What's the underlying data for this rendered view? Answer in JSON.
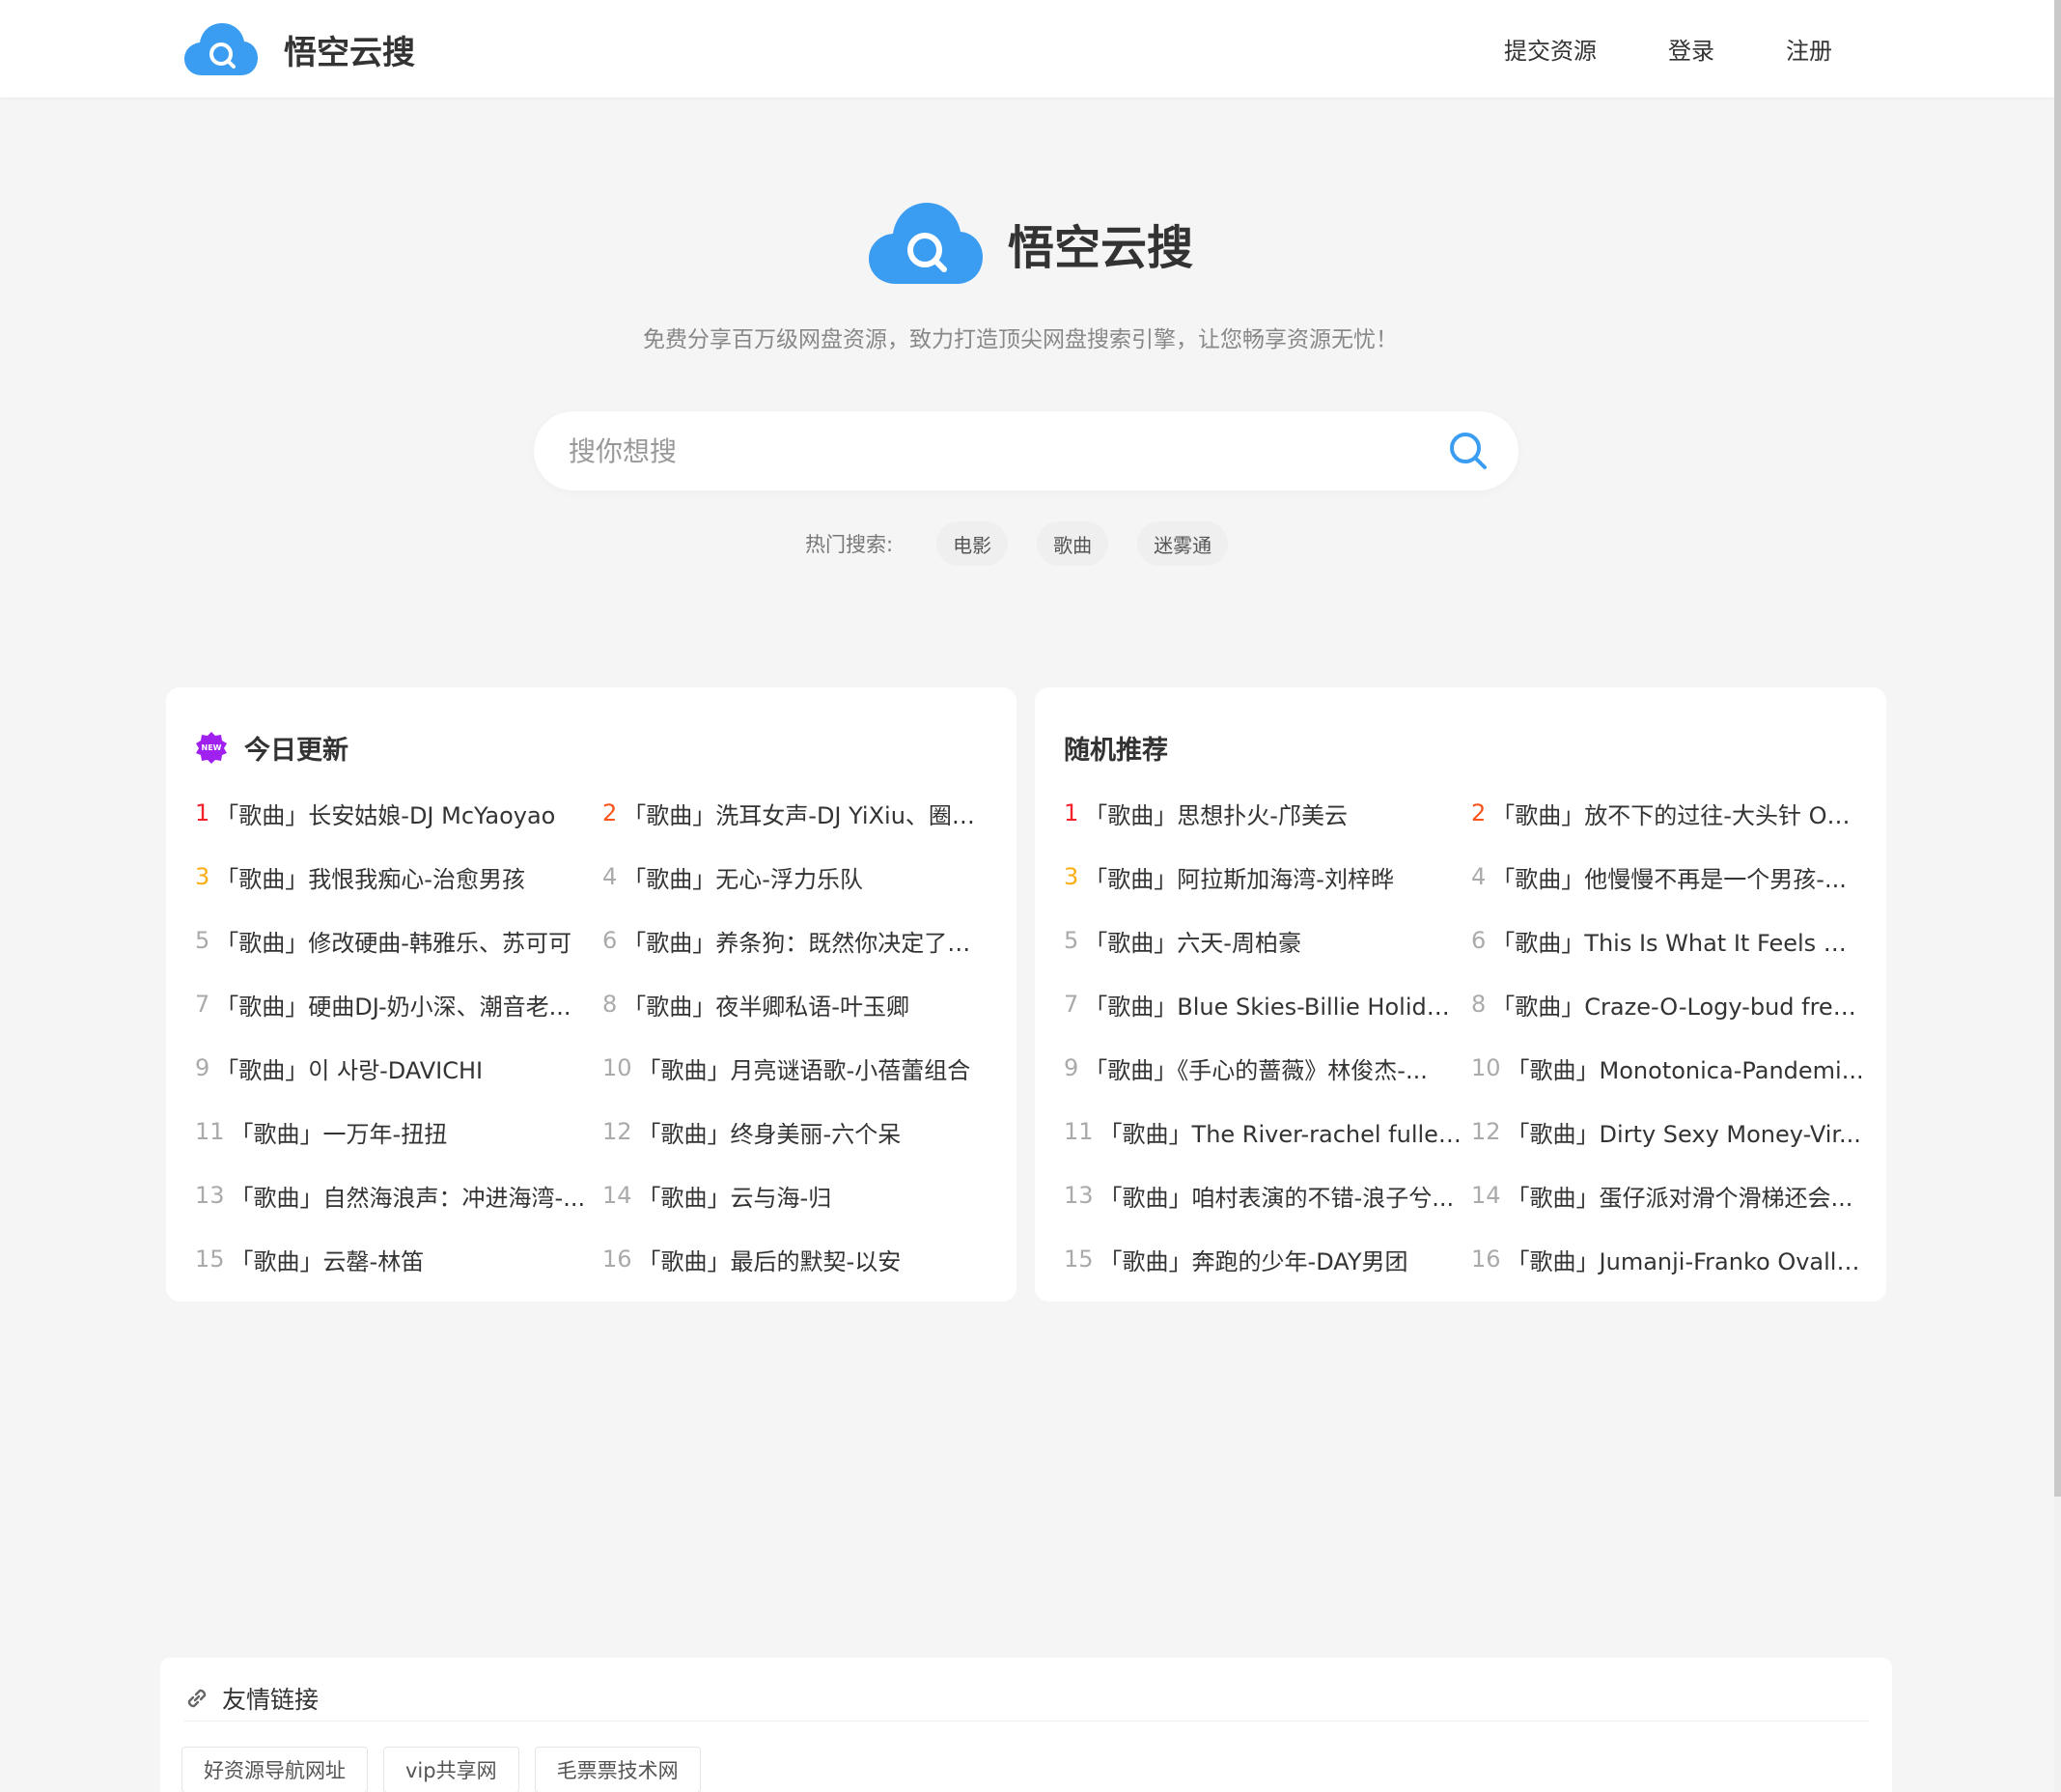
{
  "brand": {
    "name": "悟空云搜",
    "accent": "#3b9df2",
    "slogan": "免费分享百万级网盘资源，致力打造顶尖网盘搜索引擎，让您畅享资源无忧！"
  },
  "nav": {
    "submit": "提交资源",
    "login": "登录",
    "register": "注册"
  },
  "search": {
    "placeholder": "搜你想搜",
    "value": ""
  },
  "hot": {
    "label": "热门搜索:",
    "tags": [
      "电影",
      "歌曲",
      "迷雾通"
    ]
  },
  "today": {
    "title": "今日更新",
    "badge_text": "NEW",
    "items": [
      {
        "num": "1",
        "text": "「歌曲」长安姑娘-DJ McYaoyao"
      },
      {
        "num": "2",
        "text": "「歌曲」洗耳女声-DJ YiXiu、圈妹..."
      },
      {
        "num": "3",
        "text": "「歌曲」我恨我痴心-治愈男孩"
      },
      {
        "num": "4",
        "text": "「歌曲」无心-浮力乐队"
      },
      {
        "num": "5",
        "text": "「歌曲」修改硬曲-韩雅乐、苏可可"
      },
      {
        "num": "6",
        "text": "「歌曲」养条狗：既然你决定了要..."
      },
      {
        "num": "7",
        "text": "「歌曲」硬曲DJ-奶小深、潮音老..."
      },
      {
        "num": "8",
        "text": "「歌曲」夜半卿私语-叶玉卿"
      },
      {
        "num": "9",
        "text": "「歌曲」이 사랑-DAVICHI"
      },
      {
        "num": "10",
        "text": "「歌曲」月亮谜语歌-小蓓蕾组合"
      },
      {
        "num": "11",
        "text": "「歌曲」一万年-扭扭"
      },
      {
        "num": "12",
        "text": "「歌曲」终身美丽-六个呆"
      },
      {
        "num": "13",
        "text": "「歌曲」自然海浪声：冲进海湾-..."
      },
      {
        "num": "14",
        "text": "「歌曲」云与海-归"
      },
      {
        "num": "15",
        "text": "「歌曲」云罄-林笛"
      },
      {
        "num": "16",
        "text": "「歌曲」最后的默契-以安"
      }
    ]
  },
  "random": {
    "title": "随机推荐",
    "items": [
      {
        "num": "1",
        "text": "「歌曲」思想扑火-邝美云"
      },
      {
        "num": "2",
        "text": "「歌曲」放不下的过往-大头针 Off..."
      },
      {
        "num": "3",
        "text": "「歌曲」阿拉斯加海湾-刘梓晔"
      },
      {
        "num": "4",
        "text": "「歌曲」他慢慢不再是一个男孩-..."
      },
      {
        "num": "5",
        "text": "「歌曲」六天-周柏豪"
      },
      {
        "num": "6",
        "text": "「歌曲」This Is What It Feels Lik..."
      },
      {
        "num": "7",
        "text": "「歌曲」Blue Skies-Billie Holiday"
      },
      {
        "num": "8",
        "text": "「歌曲」Craze-O-Logy-bud free..."
      },
      {
        "num": "9",
        "text": "「歌曲」《手心的蔷薇》林俊杰-..."
      },
      {
        "num": "10",
        "text": "「歌曲」Monotonica-Pandemi..."
      },
      {
        "num": "11",
        "text": "「歌曲」The River-rachel fuller..."
      },
      {
        "num": "12",
        "text": "「歌曲」Dirty Sexy Money-Vir..."
      },
      {
        "num": "13",
        "text": "「歌曲」咱村表演的不错-浪子兮..."
      },
      {
        "num": "14",
        "text": "「歌曲」蛋仔派对滑个滑梯还会..."
      },
      {
        "num": "15",
        "text": "「歌曲」奔跑的少年-DAY男团"
      },
      {
        "num": "16",
        "text": "「歌曲」Jumanji-Franko Ovalle..."
      }
    ]
  },
  "links": {
    "title": "友情链接",
    "items": [
      "好资源导航网址",
      "vip共享网",
      "毛票票技术网"
    ]
  }
}
